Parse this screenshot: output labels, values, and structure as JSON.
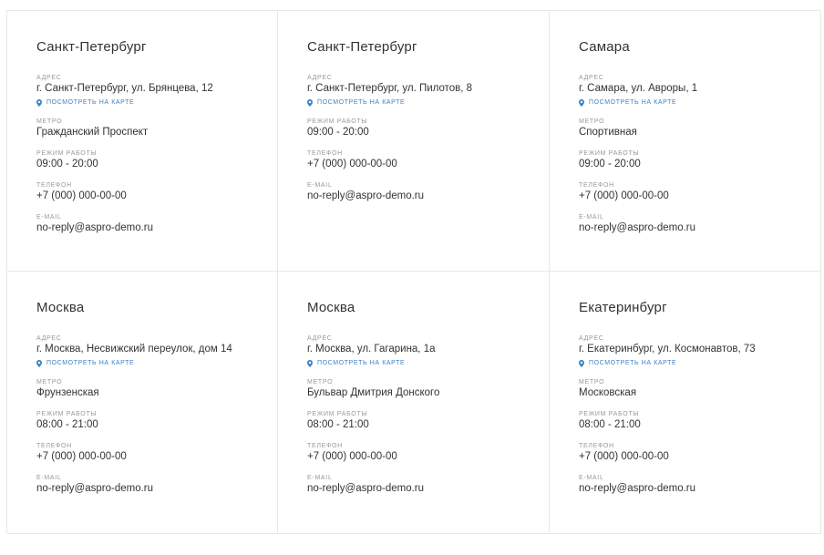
{
  "colors": {
    "link": "#3e82c6",
    "border": "#e8e8e8",
    "label": "#999999",
    "text": "#333333"
  },
  "labels": {
    "address": "Адрес",
    "map_link": "Посмотреть на карте",
    "metro": "Метро",
    "hours": "Режим работы",
    "phone": "Телефон",
    "email": "E-mail"
  },
  "offices": [
    {
      "city": "Санкт-Петербург",
      "address": "г. Санкт-Петербург, ул. Брянцева, 12",
      "metro": "Гражданский Проспект",
      "hours": "09:00 - 20:00",
      "phone": "+7 (000) 000-00-00",
      "email": "no-reply@aspro-demo.ru"
    },
    {
      "city": "Санкт-Петербург",
      "address": "г. Санкт-Петербург, ул. Пилотов, 8",
      "hours": "09:00 - 20:00",
      "phone": "+7 (000) 000-00-00",
      "email": "no-reply@aspro-demo.ru"
    },
    {
      "city": "Самара",
      "address": "г. Самара, ул. Авроры, 1",
      "metro": "Спортивная",
      "hours": "09:00 - 20:00",
      "phone": "+7 (000) 000-00-00",
      "email": "no-reply@aspro-demo.ru"
    },
    {
      "city": "Москва",
      "address": "г. Москва, Несвижский переулок, дом 14",
      "metro": "Фрунзенская",
      "hours": "08:00 - 21:00",
      "phone": "+7 (000) 000-00-00",
      "email": "no-reply@aspro-demo.ru"
    },
    {
      "city": "Москва",
      "address": "г. Москва, ул. Гагарина, 1а",
      "metro": "Бульвар Дмитрия Донского",
      "hours": "08:00 - 21:00",
      "phone": "+7 (000) 000-00-00",
      "email": "no-reply@aspro-demo.ru"
    },
    {
      "city": "Екатеринбург",
      "address": "г. Екатеринбург, ул. Космонавтов, 73",
      "metro": "Московская",
      "hours": "08:00 - 21:00",
      "phone": "+7 (000) 000-00-00",
      "email": "no-reply@aspro-demo.ru"
    }
  ]
}
